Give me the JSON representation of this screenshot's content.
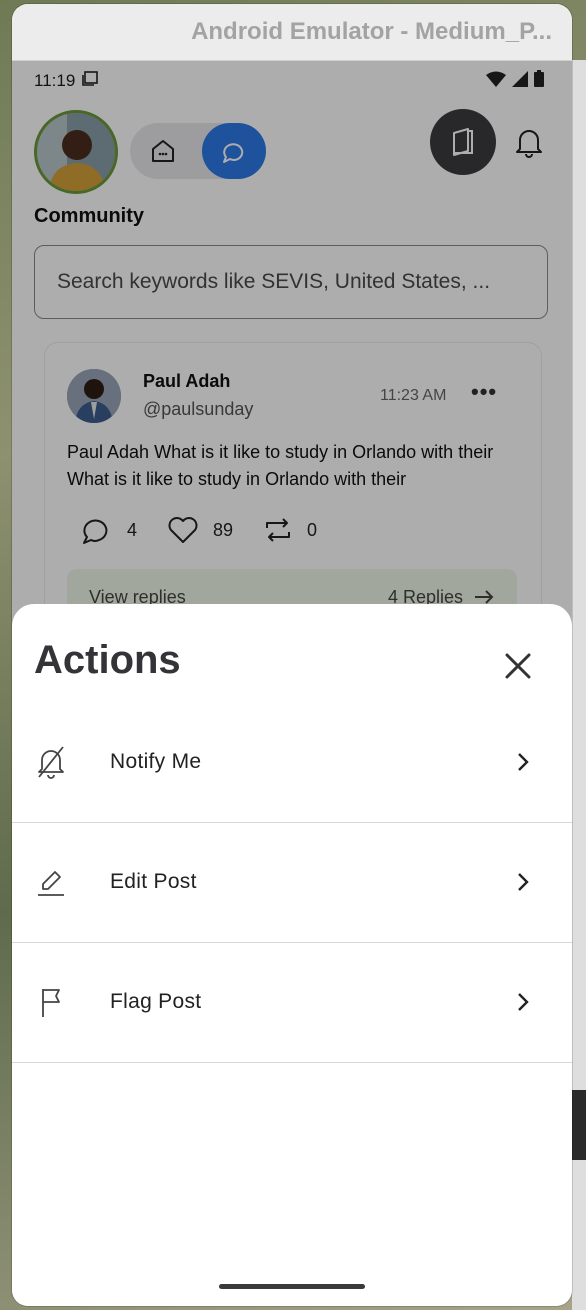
{
  "window": {
    "title": "Android Emulator - Medium_P..."
  },
  "status_bar": {
    "time": "11:19"
  },
  "header": {
    "section_title": "Community",
    "search_placeholder": "Search keywords like SEVIS, United States, ..."
  },
  "post": {
    "author_name": "Paul Adah",
    "author_handle": "@paulsunday",
    "time": "11:23 AM",
    "more": "•••",
    "body": "Paul Adah What is it like to study in Orlando with their What is it like to study in Orlando with their",
    "comments": "4",
    "likes": "89",
    "reposts": "0",
    "view_replies": "View replies",
    "replies_count": "4 Replies"
  },
  "sheet": {
    "title": "Actions",
    "actions": [
      {
        "label": "Notify Me",
        "icon": "bell-off-icon"
      },
      {
        "label": "Edit Post",
        "icon": "pencil-icon"
      },
      {
        "label": "Flag Post",
        "icon": "flag-icon"
      }
    ]
  },
  "colors": {
    "accent": "#2e79e6",
    "avatar_ring": "#6a9a3a"
  }
}
